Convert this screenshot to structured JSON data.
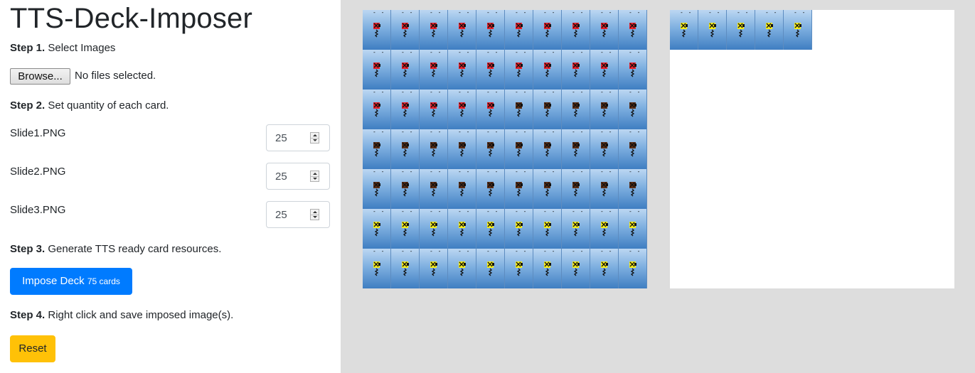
{
  "app": {
    "title": "TTS-Deck-Imposer"
  },
  "step1": {
    "bold": "Step 1.",
    "text": "Select Images"
  },
  "file_input": {
    "button_label": "Browse...",
    "status": "No files selected."
  },
  "step2": {
    "bold": "Step 2.",
    "text": "Set quantity of each card."
  },
  "cards": [
    {
      "name": "Slide1.PNG",
      "quantity": "25",
      "color": "#e8202a"
    },
    {
      "name": "Slide2.PNG",
      "quantity": "25",
      "color": "#5a2e16"
    },
    {
      "name": "Slide3.PNG",
      "quantity": "25",
      "color": "#f5ec1a"
    }
  ],
  "step3": {
    "bold": "Step 3.",
    "text": "Generate TTS ready card resources."
  },
  "impose_button": {
    "label": "Impose Deck",
    "count": "75 cards",
    "color": "#007bff"
  },
  "step4": {
    "bold": "Step 4.",
    "text": "Right click and save imposed image(s)."
  },
  "reset_button": {
    "label": "Reset",
    "color": "#ffc107"
  },
  "imposed_sheets": [
    {
      "columns": 10,
      "rows": 7,
      "card_count": 70
    },
    {
      "columns": 10,
      "rows": 7,
      "card_count": 5
    }
  ],
  "card_face_text": "- -"
}
